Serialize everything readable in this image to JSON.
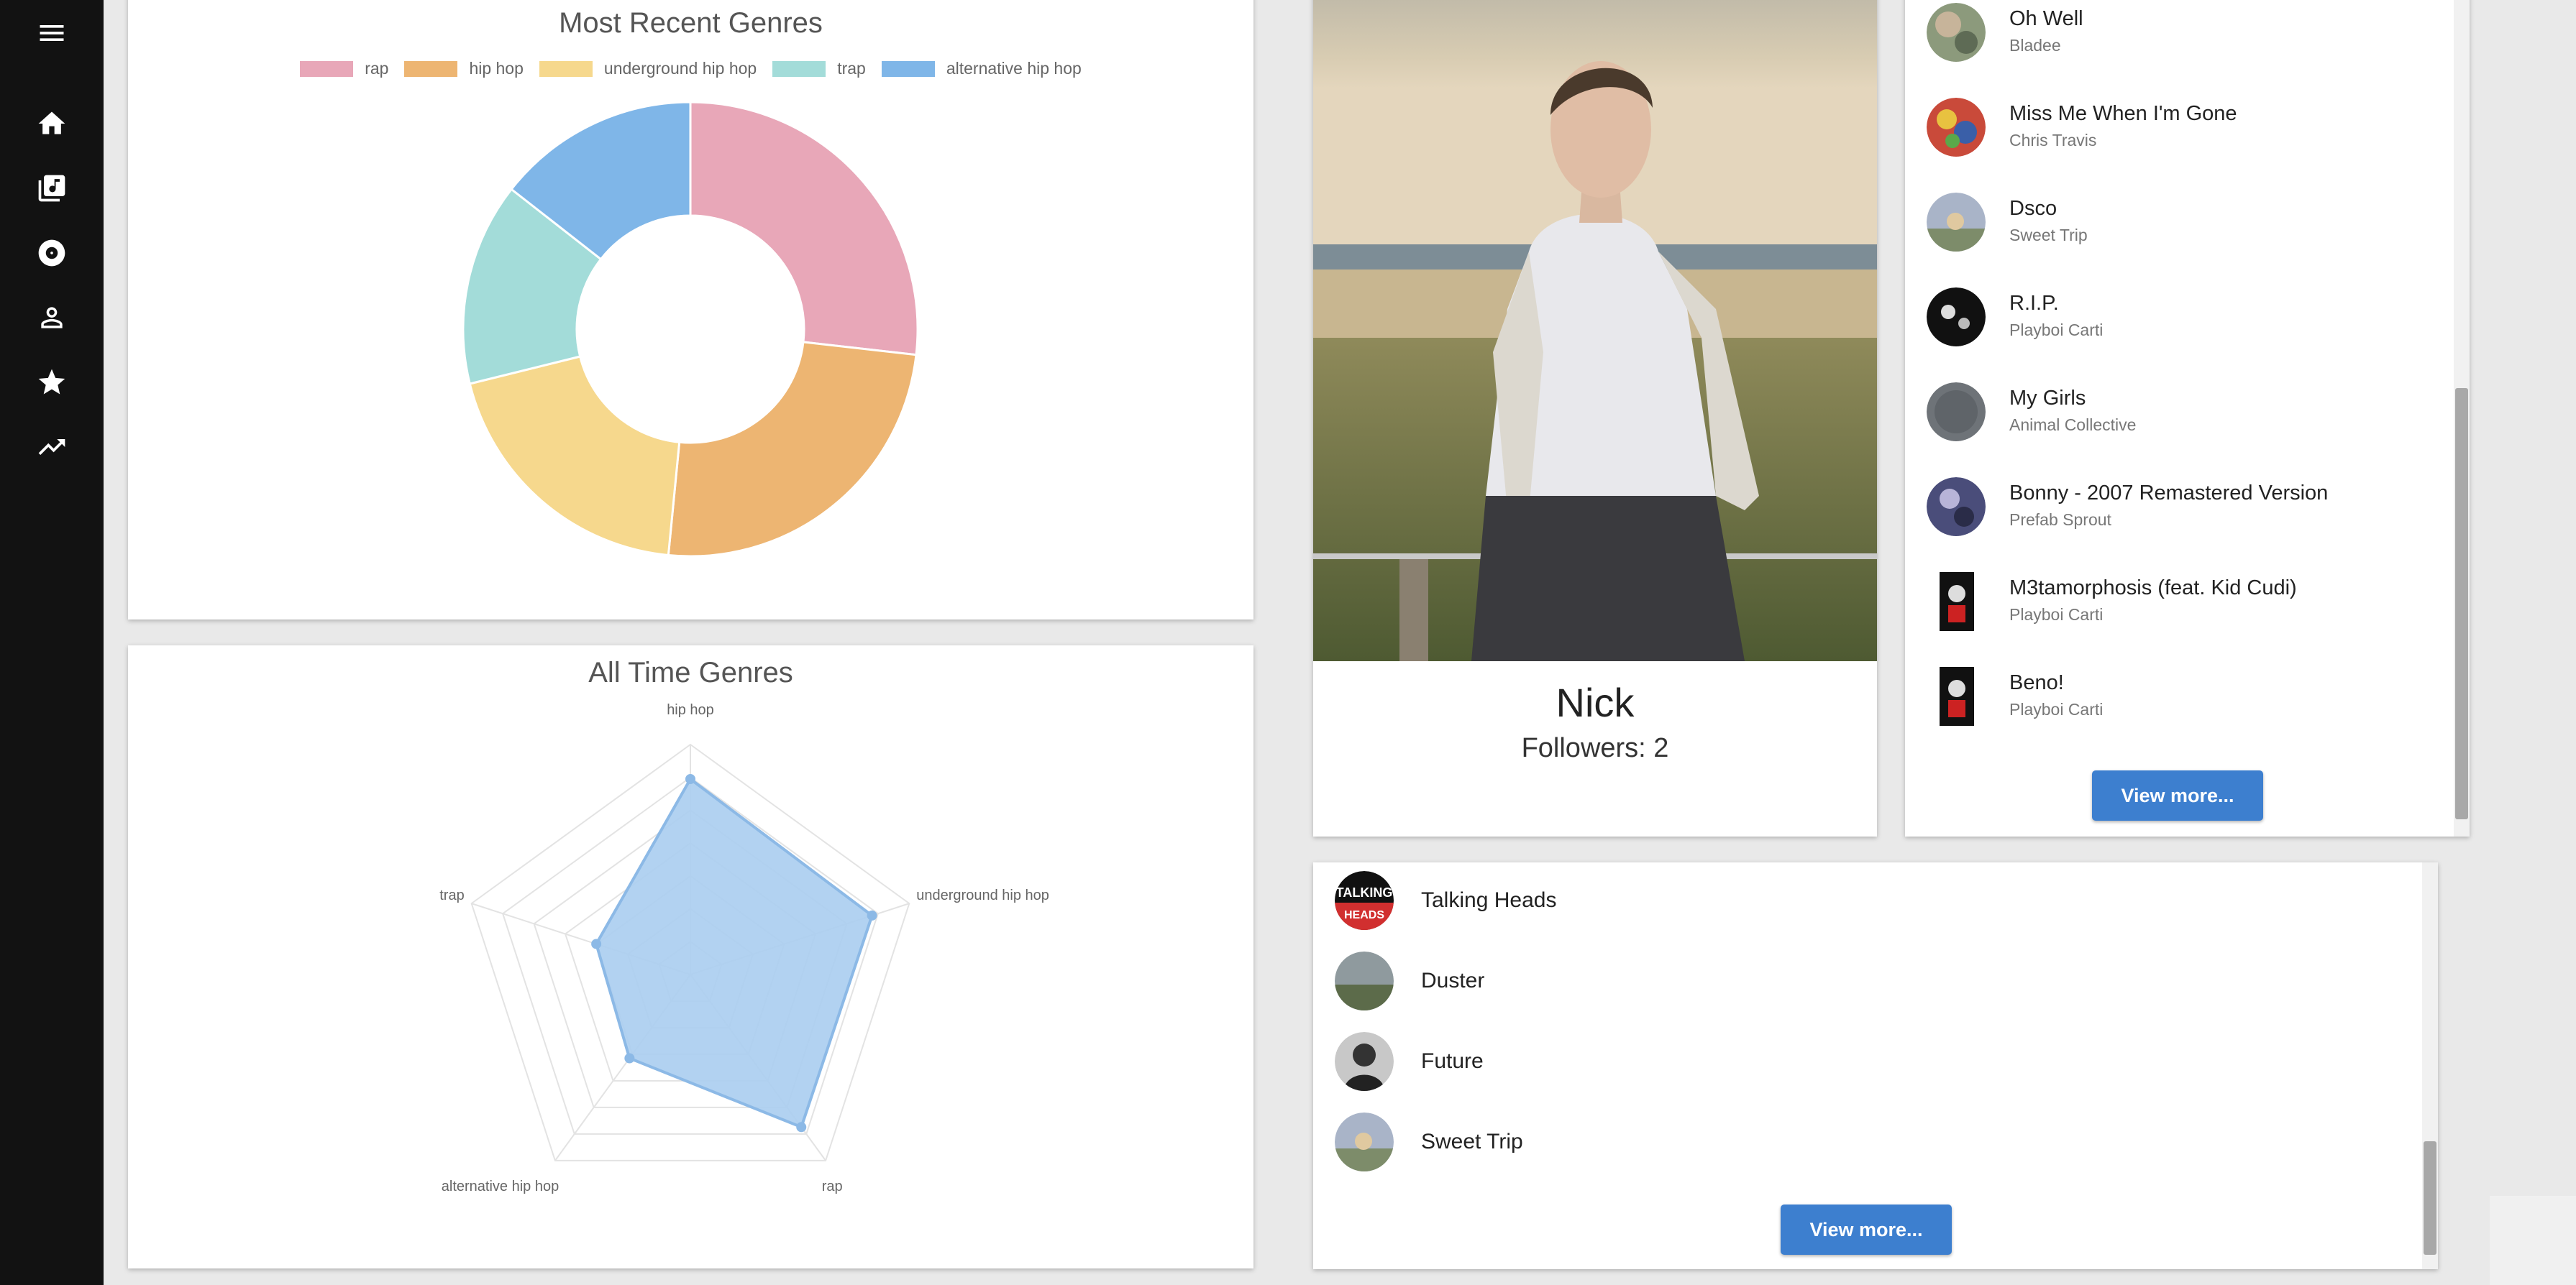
{
  "nav": {
    "icons": [
      "menu-icon",
      "home-icon",
      "library-music-icon",
      "album-icon",
      "person-icon",
      "star-icon",
      "trending-up-icon"
    ]
  },
  "recent_genres": {
    "chart_data": {
      "type": "pie",
      "title": "Most Recent Genres",
      "categories": [
        "rap",
        "hip hop",
        "underground hip hop",
        "trap",
        "alternative hip hop"
      ],
      "values": [
        26,
        24,
        19,
        14,
        14
      ],
      "colors": [
        "#e8a7b8",
        "#edb572",
        "#f6d88d",
        "#a3dcd9",
        "#7fb6e8"
      ],
      "legend": "top",
      "hole_fraction": 0.5
    }
  },
  "all_time_genres": {
    "chart_data": {
      "type": "radar",
      "title": "All Time Genres",
      "categories": [
        "hip hop",
        "underground hip hop",
        "rap",
        "alternative hip hop",
        "trap"
      ],
      "values": [
        8.5,
        8.3,
        8.2,
        4.5,
        4.3
      ],
      "rmax": 10,
      "rings": 7,
      "fill_color": "#aacdf0",
      "line_color": "#8cb9e6"
    }
  },
  "profile": {
    "name": "Nick",
    "followers": "Followers: 2"
  },
  "recent_tracks": {
    "items": [
      {
        "title": "Oh Well",
        "artist": "Bladee"
      },
      {
        "title": "Miss Me When I'm Gone",
        "artist": "Chris Travis"
      },
      {
        "title": "Dsco",
        "artist": "Sweet Trip"
      },
      {
        "title": "R.I.P.",
        "artist": "Playboi Carti"
      },
      {
        "title": "My Girls",
        "artist": "Animal Collective"
      },
      {
        "title": "Bonny - 2007 Remastered Version",
        "artist": "Prefab Sprout"
      },
      {
        "title": "M3tamorphosis (feat. Kid Cudi)",
        "artist": "Playboi Carti"
      },
      {
        "title": "Beno!",
        "artist": "Playboi Carti"
      }
    ],
    "view_more": "View more..."
  },
  "top_artists": {
    "items": [
      {
        "name": "Talking Heads"
      },
      {
        "name": "Duster"
      },
      {
        "name": "Future"
      },
      {
        "name": "Sweet Trip"
      }
    ],
    "view_more": "View more..."
  }
}
